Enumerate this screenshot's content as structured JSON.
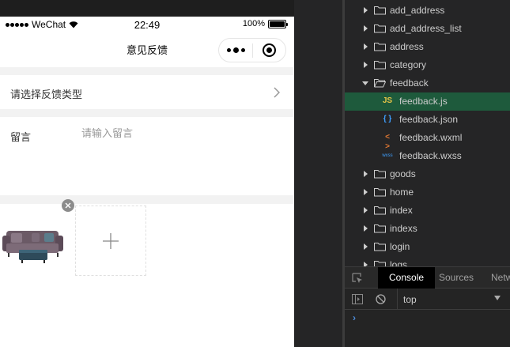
{
  "phone": {
    "status": {
      "carrier": "WeChat",
      "time": "22:49",
      "battery": "100%"
    },
    "nav": {
      "title": "意见反馈"
    },
    "form": {
      "type_label": "请选择反馈类型",
      "message_label": "留言",
      "message_placeholder": "请输入留言",
      "photos": [
        {
          "kind": "sofa-image"
        }
      ]
    }
  },
  "explorer": {
    "items": [
      {
        "type": "folder",
        "label": "add_address",
        "expanded": false
      },
      {
        "type": "folder",
        "label": "add_address_list",
        "expanded": false
      },
      {
        "type": "folder",
        "label": "address",
        "expanded": false
      },
      {
        "type": "folder",
        "label": "category",
        "expanded": false
      },
      {
        "type": "folder",
        "label": "feedback",
        "expanded": true
      },
      {
        "type": "file",
        "label": "feedback.js",
        "badge": "JS",
        "badge_color": "#e8c547",
        "active": true
      },
      {
        "type": "file",
        "label": "feedback.json",
        "badge": "{ }",
        "badge_color": "#3fa0ff"
      },
      {
        "type": "file",
        "label": "feedback.wxml",
        "badge": "< >",
        "badge_color": "#e37933"
      },
      {
        "type": "file",
        "label": "feedback.wxss",
        "badge": "wxss",
        "badge_color": "#3fa0ff"
      },
      {
        "type": "folder",
        "label": "goods",
        "expanded": false
      },
      {
        "type": "folder",
        "label": "home",
        "expanded": false
      },
      {
        "type": "folder",
        "label": "index",
        "expanded": false
      },
      {
        "type": "folder",
        "label": "indexs",
        "expanded": false
      },
      {
        "type": "folder",
        "label": "login",
        "expanded": false
      },
      {
        "type": "folder",
        "label": "logs",
        "expanded": false
      }
    ]
  },
  "devtools": {
    "tabs": [
      "Console",
      "Sources",
      "Netw"
    ],
    "active_tab": "Console",
    "context": "top",
    "prompt": "›"
  },
  "colors": {
    "active_row": "#1e5a3c",
    "accent_blue": "#4d8ddc",
    "page_bg": "#f2f2f2"
  }
}
